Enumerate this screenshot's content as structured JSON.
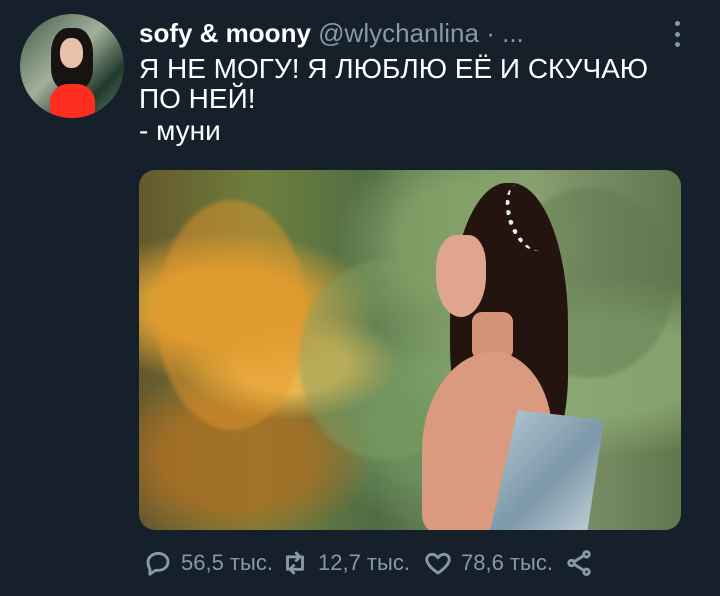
{
  "tweet": {
    "author": {
      "display_name": "sofy & moony",
      "username": "@wlychanlina",
      "separator": "·",
      "time_placeholder": "..."
    },
    "text": {
      "line1": "Я НЕ МОГУ! Я ЛЮБЛЮ ЕЁ И СКУЧАЮ ПО НЕЙ!",
      "signature": "- муни"
    },
    "actions": {
      "reply_count": "56,5 тыс.",
      "retweet_count": "12,7 тыс.",
      "like_count": "78,6 тыс."
    },
    "colors": {
      "background": "#15202b",
      "text": "#ffffff",
      "secondary": "#8899a6"
    },
    "icons": {
      "more": "more-vertical-icon",
      "reply": "reply-icon",
      "retweet": "retweet-icon",
      "like": "heart-icon",
      "share": "share-icon"
    }
  }
}
